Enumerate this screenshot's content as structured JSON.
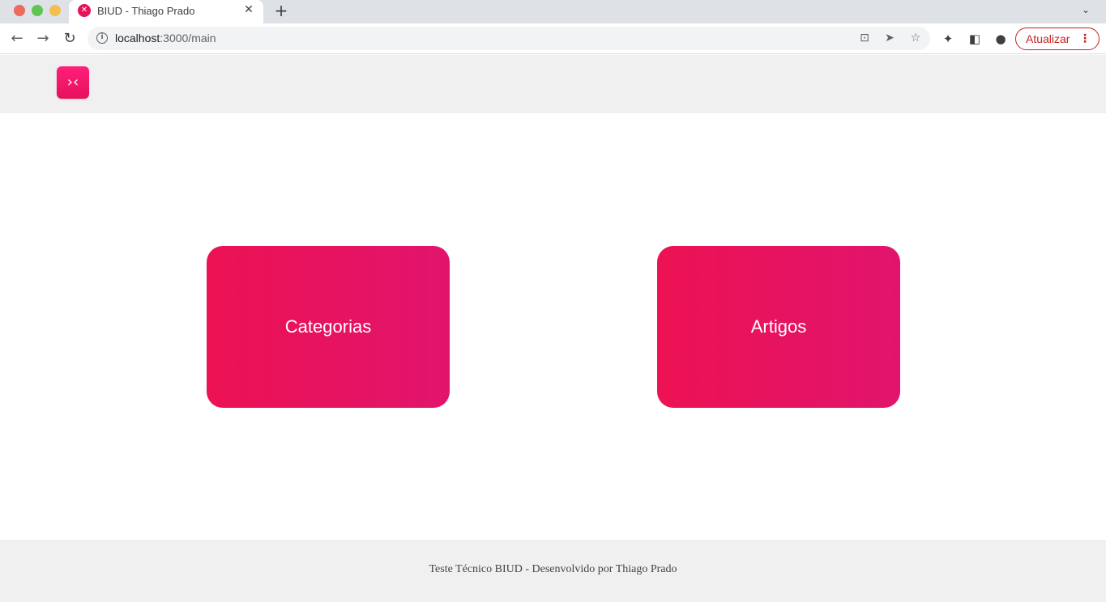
{
  "browser": {
    "tab": {
      "title": "BIUD - Thiago Prado",
      "favicon_icon": "biud-x-icon",
      "close_glyph": "✕"
    },
    "new_tab_glyph": "+",
    "tab_menu_glyph": "⌄",
    "nav": {
      "back_glyph": "←",
      "forward_glyph": "→",
      "reload_glyph": "↻"
    },
    "omnibox": {
      "host": "localhost",
      "path": ":3000/main",
      "info_glyph": "i"
    },
    "omnibox_icons": {
      "translate": "⊡",
      "send": "➤",
      "star": "☆"
    },
    "toolbar_icons": {
      "extensions": "✦",
      "side_panel": "◧",
      "profile": "●"
    },
    "update_button": {
      "label": "Atualizar",
      "menu_glyph": "⋮"
    }
  },
  "header": {
    "logo_glyph": "›‹",
    "brand_color": "#e8115c"
  },
  "main": {
    "cards": [
      {
        "label": "Categorias"
      },
      {
        "label": "Artigos"
      }
    ]
  },
  "footer": {
    "text": "Teste Técnico BIUD - Desenvolvido por Thiago Prado"
  }
}
